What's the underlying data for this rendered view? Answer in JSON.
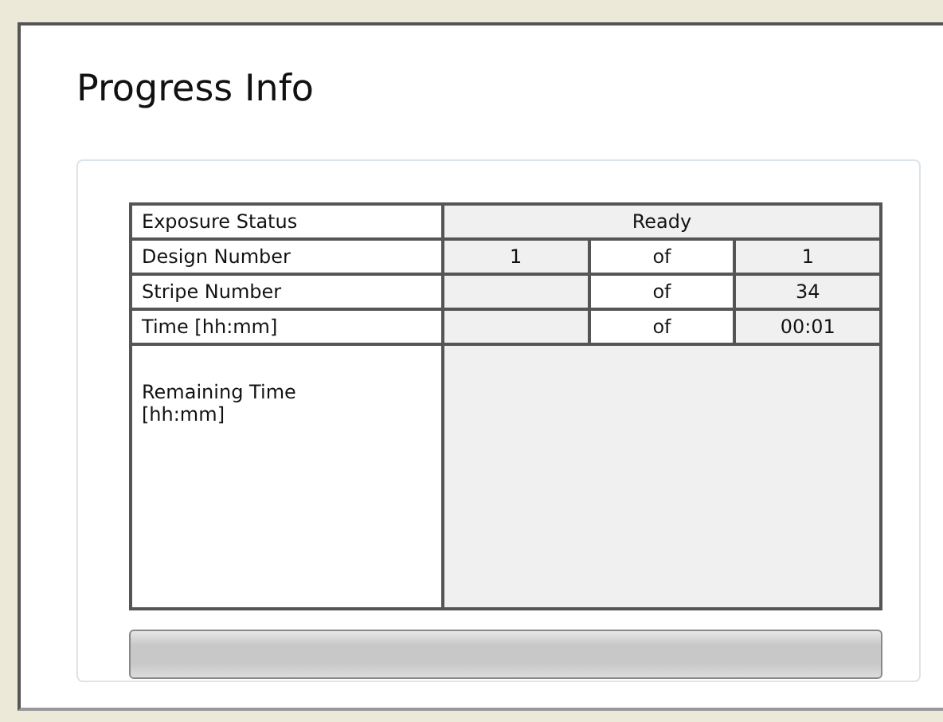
{
  "title": "Progress Info",
  "rows": [
    {
      "kind": "status",
      "label": "Exposure Status",
      "value": "Ready"
    },
    {
      "kind": "count",
      "label": "Design Number",
      "current": "1",
      "of": "of",
      "total": "1"
    },
    {
      "kind": "count",
      "label": "Stripe Number",
      "of": "of",
      "total": "34"
    },
    {
      "kind": "count",
      "label": "Time [hh:mm]",
      "of": "of",
      "total": "00:01"
    },
    {
      "kind": "tall",
      "label": "Remaining Time [hh:mm]"
    }
  ],
  "progress": {
    "level": 0
  }
}
